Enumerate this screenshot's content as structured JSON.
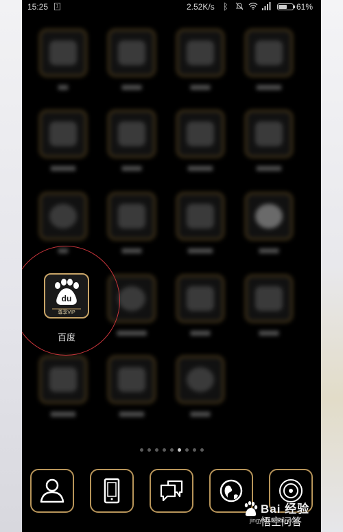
{
  "status_bar": {
    "time": "15:25",
    "network_speed": "2.52K/s",
    "battery_percent": "61%",
    "battery_level": 0.61,
    "icons": [
      "sim-card-icon",
      "bluetooth-icon",
      "mute-icon",
      "wifi-icon",
      "signal-icon",
      "battery-icon"
    ]
  },
  "focused_app": {
    "label": "百度",
    "icon": "baidu-paw-icon",
    "icon_text": "du",
    "icon_subtext": "尊享VIP",
    "ring_color": "#c5343a"
  },
  "page_indicator": {
    "count": 9,
    "active_index": 5
  },
  "dock": {
    "items": [
      {
        "name": "contacts",
        "icon": "person-icon"
      },
      {
        "name": "phone",
        "icon": "phone-icon"
      },
      {
        "name": "messages",
        "icon": "chat-bubbles-icon"
      },
      {
        "name": "browser",
        "icon": "globe-icon"
      },
      {
        "name": "camera",
        "icon": "camera-lens-icon"
      }
    ],
    "border_color": "#b8955a"
  },
  "watermark": {
    "main": "Bai 经验",
    "sub": "悟空问答",
    "url": "jingyan.baidu.com"
  }
}
